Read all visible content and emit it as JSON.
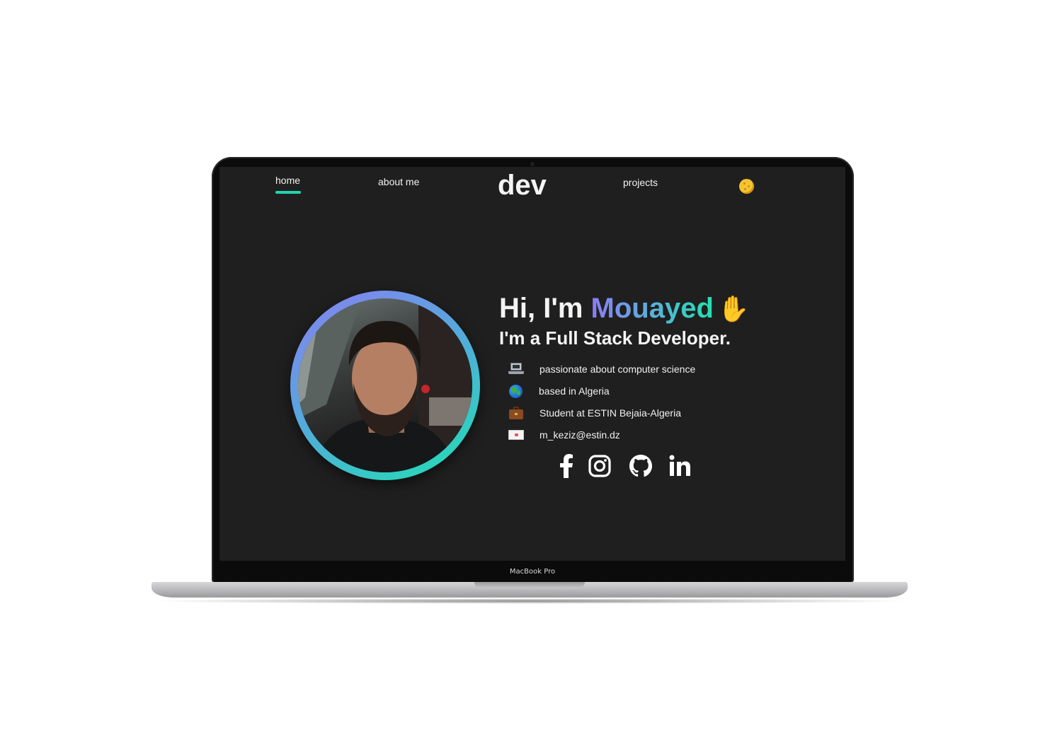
{
  "device": {
    "label": "MacBook Pro"
  },
  "nav": {
    "home": "home",
    "about": "about me",
    "logo": "dev",
    "projects": "projects",
    "theme_toggle_icon": "moon-icon"
  },
  "hero": {
    "greeting": "Hi, I'm ",
    "name": "Mouayed",
    "wave_icon": "✋",
    "subtitle": "I'm a Full Stack Developer.",
    "facts": [
      {
        "icon": "laptop-icon",
        "text": "passionate about computer science"
      },
      {
        "icon": "globe-icon",
        "text": "based in Algeria"
      },
      {
        "icon": "briefcase-icon",
        "text": "Student at ESTIN Bejaia-Algeria"
      },
      {
        "icon": "envelope-icon",
        "text": "m_keziz@estin.dz"
      }
    ],
    "social": [
      "facebook-icon",
      "instagram-icon",
      "github-icon",
      "linkedin-icon"
    ]
  },
  "colors": {
    "accent": "#23d3b0",
    "name_gradient_start": "#8b7cf3",
    "name_gradient_end": "#22e0b0",
    "screen_bg": "#1f1f1f"
  }
}
